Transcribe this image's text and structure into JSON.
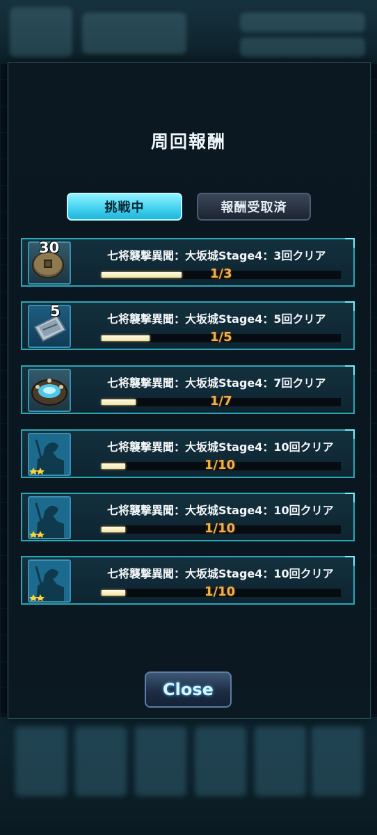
{
  "modal": {
    "title": "周回報酬",
    "tabs": [
      {
        "label": "挑戦中",
        "active": true
      },
      {
        "label": "報酬受取済",
        "active": false
      }
    ],
    "rewards": [
      {
        "label": "七将襲撃異聞：大坂城Stage4：3回クリア",
        "quantity": "30",
        "icon": "coin-icon",
        "progress_text": "1/3",
        "progress": 0.333
      },
      {
        "label": "七将襲撃異聞：大坂城Stage4：5回クリア",
        "quantity": "5",
        "icon": "ticket-icon",
        "progress_text": "1/5",
        "progress": 0.2
      },
      {
        "label": "七将襲撃異聞：大坂城Stage4：7回クリア",
        "quantity": "",
        "icon": "gem-stone-icon",
        "progress_text": "1/7",
        "progress": 0.143
      },
      {
        "label": "七将襲撃異聞：大坂城Stage4：10回クリア",
        "quantity": "",
        "icon": "warrior-silhouette-icon",
        "progress_text": "1/10",
        "progress": 0.1
      },
      {
        "label": "七将襲撃異聞：大坂城Stage4：10回クリア",
        "quantity": "",
        "icon": "warrior-silhouette-icon",
        "progress_text": "1/10",
        "progress": 0.1
      },
      {
        "label": "七将襲撃異聞：大坂城Stage4：10回クリア",
        "quantity": "",
        "icon": "warrior-silhouette-icon",
        "progress_text": "1/10",
        "progress": 0.1
      }
    ],
    "close_label": "Close"
  },
  "colors": {
    "accent": "#2aa8b8",
    "tab_active": "#45d3f0",
    "progress_fill": "#f3e3a4",
    "progress_text": "#f2b24a"
  }
}
